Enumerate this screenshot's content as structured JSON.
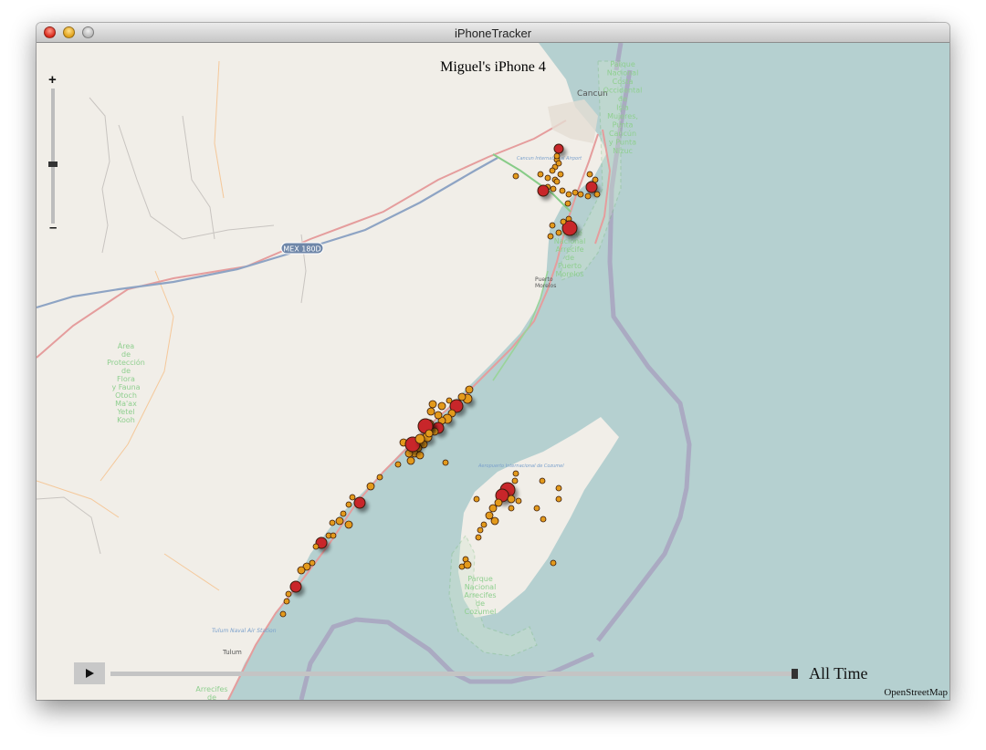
{
  "window": {
    "title": "iPhoneTracker",
    "controls": [
      "close",
      "minimize",
      "maximize"
    ]
  },
  "map": {
    "device_title": "Miguel's iPhone 4",
    "zoom": {
      "plus_label": "+",
      "minus_label": "–",
      "level": 0.45
    },
    "timeline": {
      "label": "All Time",
      "position": 1.0,
      "play_icon": "play-icon"
    },
    "attribution": "OpenStreetMap",
    "place_labels": {
      "cancun": "Cancun",
      "puerto_morelos_1": "Puerto",
      "puerto_morelos_2": "Morelos",
      "tulum": "Tulum",
      "tulum_air": "Tulum Naval Air Station",
      "cancun_air": "Cancun International Airport",
      "cozumel_air": "Aeropuerto Internacional de Cozumel",
      "highway": "MEX 180D"
    },
    "park_labels": {
      "isla_mujeres": [
        "Parque",
        "Nacional",
        "Costa",
        "Occidental",
        "de",
        "Isla",
        "Mujeres,",
        "Punta",
        "Cancún",
        "y Punta",
        "Nizuc"
      ],
      "puerto_morelos": [
        "Parque",
        "Nacional",
        "Arrecife",
        "de",
        "Puerto",
        "Morelos"
      ],
      "otoch": [
        "Área",
        "de",
        "Protección",
        "de",
        "Flora",
        "y Fauna",
        "Otoch",
        "Ma'ax",
        "Yetel",
        "Kooh"
      ],
      "cozumel": [
        "Parque",
        "Nacional",
        "Arrecifes",
        "de",
        "Cozumel"
      ],
      "sian_kaan": [
        "Arrecifes",
        "de"
      ]
    },
    "colors": {
      "land": "#f1eee8",
      "sea": "#b5d0d0",
      "park_text": "#8fcf8f",
      "point_small": "#e39a1c",
      "point_large": "#c8282a"
    }
  }
}
